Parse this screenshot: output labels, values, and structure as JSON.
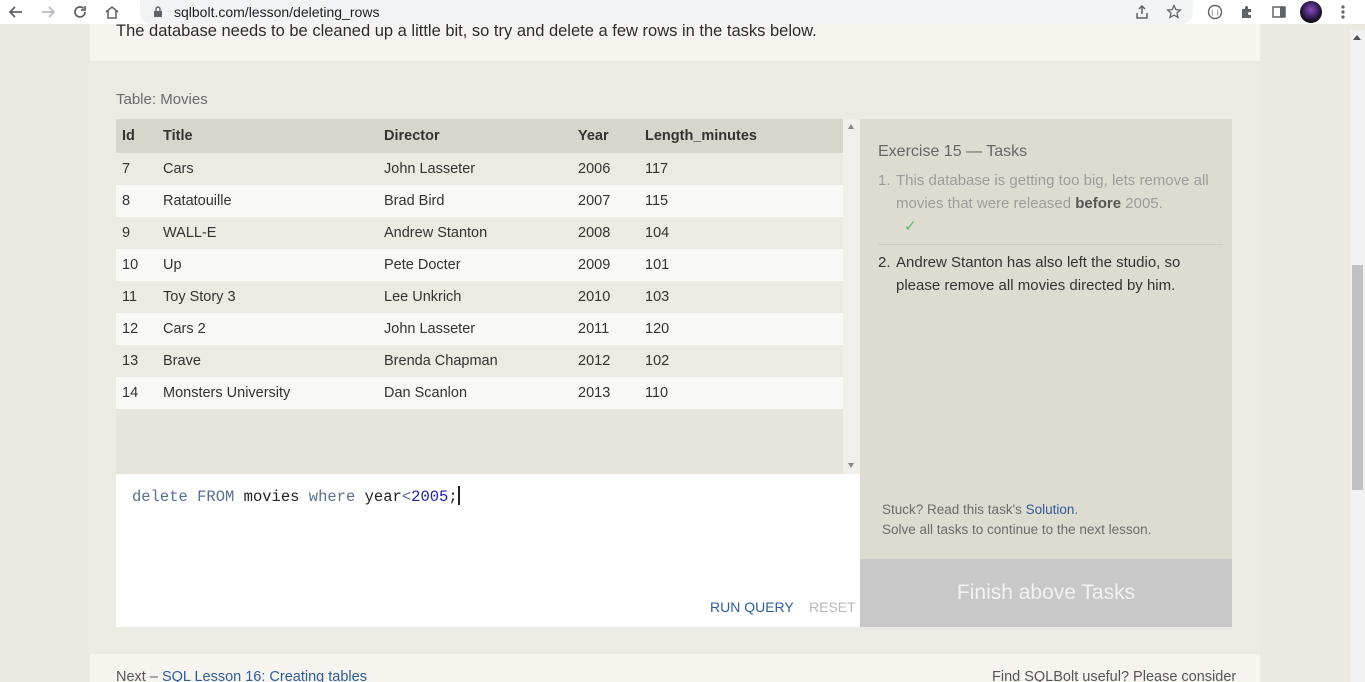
{
  "browser": {
    "url": "sqlbolt.com/lesson/deleting_rows"
  },
  "page": {
    "intro_text": "The database needs to be cleaned up a little bit, so try and delete a few rows in the tasks below.",
    "table_caption": "Table: Movies",
    "table": {
      "headers": [
        "Id",
        "Title",
        "Director",
        "Year",
        "Length_minutes"
      ],
      "rows": [
        [
          "7",
          "Cars",
          "John Lasseter",
          "2006",
          "117"
        ],
        [
          "8",
          "Ratatouille",
          "Brad Bird",
          "2007",
          "115"
        ],
        [
          "9",
          "WALL-E",
          "Andrew Stanton",
          "2008",
          "104"
        ],
        [
          "10",
          "Up",
          "Pete Docter",
          "2009",
          "101"
        ],
        [
          "11",
          "Toy Story 3",
          "Lee Unkrich",
          "2010",
          "103"
        ],
        [
          "12",
          "Cars 2",
          "John Lasseter",
          "2011",
          "120"
        ],
        [
          "13",
          "Brave",
          "Brenda Chapman",
          "2012",
          "102"
        ],
        [
          "14",
          "Monsters University",
          "Dan Scanlon",
          "2013",
          "110"
        ]
      ]
    },
    "editor": {
      "kw1": "delete",
      "kw2": "FROM",
      "table_name": "movies",
      "kw3": "where",
      "column": "year",
      "op": "<",
      "value": "2005",
      "semicolon": ";"
    },
    "buttons": {
      "run_query": "RUN QUERY",
      "reset": "RESET"
    },
    "tasks": {
      "title": "Exercise 15 — Tasks",
      "task1_num": "1.",
      "task1_pre": "This database is getting too big, lets remove all movies that were released ",
      "task1_bold": "before",
      "task1_post": " 2005.",
      "task1_check": "✓",
      "task2_num": "2.",
      "task2_text": "Andrew Stanton has also left the studio, so please remove all movies directed by him.",
      "stuck_pre": "Stuck? Read this task's ",
      "solution_link": "Solution",
      "stuck_post": ".",
      "solve_all": "Solve all tasks to continue to the next lesson.",
      "finish_label": "Finish above Tasks"
    },
    "footer": {
      "next_prefix": "Next – ",
      "next_link": "SQL Lesson 16: Creating tables",
      "useful_text": "Find SQLBolt useful? Please consider"
    }
  }
}
